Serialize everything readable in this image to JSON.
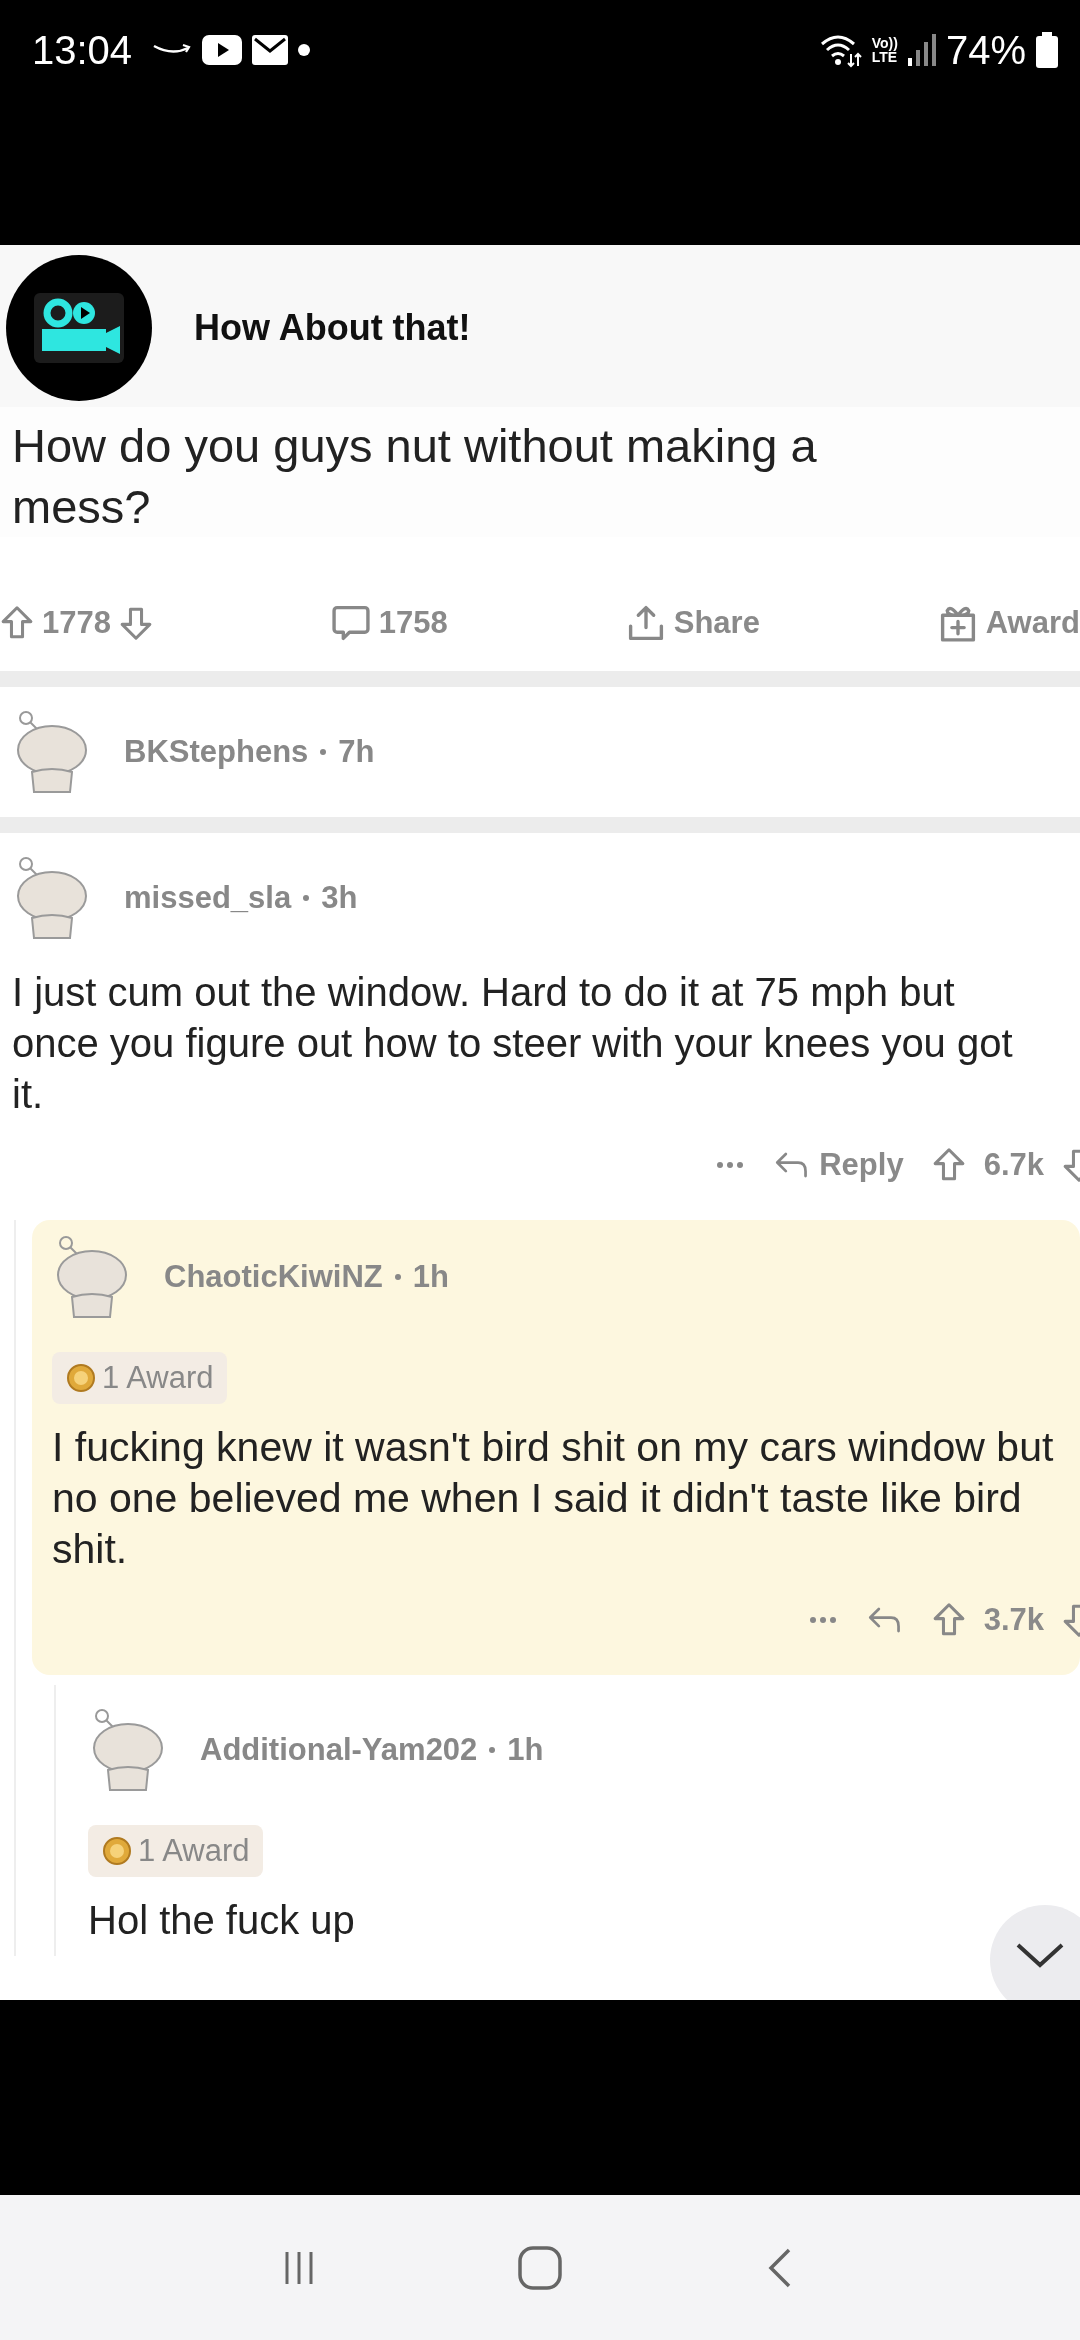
{
  "status_bar": {
    "time": "13:04",
    "volte_top": "Vo))",
    "volte_bottom": "LTE",
    "battery": "74%"
  },
  "post": {
    "community": "How About that!",
    "title": "How do you guys nut without making a mess?",
    "votes": "1778",
    "comments": "1758",
    "share": "Share",
    "award": "Award"
  },
  "comments": [
    {
      "user": "BKStephens",
      "time": "7h",
      "highlighted": false
    },
    {
      "user": "missed_sla",
      "time": "3h",
      "highlighted": false,
      "body": "I just cum out the window. Hard to do it at 75 mph but once you figure out how to steer with your knees you got it.",
      "reply_label": "Reply",
      "score": "6.7k",
      "children": [
        {
          "user": "ChaoticKiwiNZ",
          "time": "1h",
          "highlighted": true,
          "award": "1 Award",
          "body": "I fucking knew it wasn't bird shit on my cars window but no one believed me when I said it didn't taste like bird shit.",
          "score": "3.7k",
          "children": [
            {
              "user": "Additional-Yam202",
              "time": "1h",
              "highlighted": false,
              "award": "1 Award",
              "body": "Hol the fuck up"
            }
          ]
        }
      ]
    }
  ]
}
